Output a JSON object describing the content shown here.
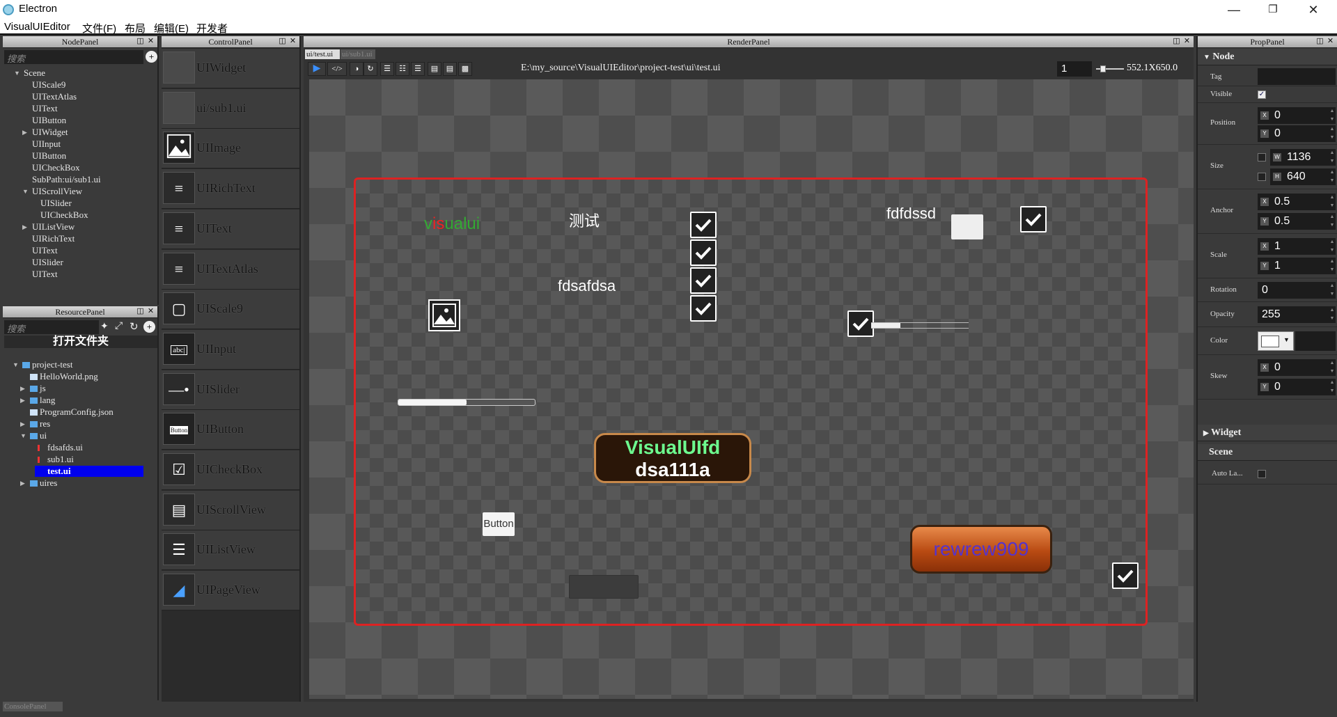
{
  "window": {
    "title": "Electron"
  },
  "menu": [
    "VisualUIEditor",
    "文件(F)",
    "布局",
    "编辑(E)",
    "开发者"
  ],
  "node_panel": {
    "title": "NodePanel",
    "search_placeholder": "搜索",
    "items": [
      "Scene",
      "UIScale9",
      "UITextAtlas",
      "UIText",
      "UIButton",
      "UIWidget",
      "UIInput",
      "UIButton",
      "UICheckBox",
      "SubPath:ui/sub1.ui",
      "UIScrollView",
      "UISlider",
      "UICheckBox",
      "UIListView",
      "UIRichText",
      "UIText",
      "UISlider",
      "UIText"
    ]
  },
  "resource_panel": {
    "title": "ResourcePanel",
    "search_placeholder": "搜索",
    "open_folder": "打开文件夹",
    "items": [
      "project-test",
      "HelloWorld.png",
      "js",
      "lang",
      "ProgramConfig.json",
      "res",
      "ui",
      "fdsafds.ui",
      "sub1.ui",
      "test.ui",
      "uires"
    ]
  },
  "console_panel": {
    "title": "ConsolePanel"
  },
  "control_panel": {
    "title": "ControlPanel",
    "items": [
      "UIWidget",
      "ui/sub1.ui",
      "UIImage",
      "UIRichText",
      "UIText",
      "UITextAtlas",
      "UIScale9",
      "UIInput",
      "UISlider",
      "UIButton",
      "UICheckBox",
      "UIScrollView",
      "UIListView",
      "UIPageView"
    ],
    "button_icon_text": "Button",
    "input_icon_text": "abc|"
  },
  "render_panel": {
    "title": "RenderPanel",
    "tabs": [
      "ui/test.ui",
      "ui/sub1.ui"
    ],
    "path": "E:\\my_source\\VisualUIEditor\\project-test\\ui\\test.ui",
    "zoom_value": "1",
    "size_readout": "552.1X650.0"
  },
  "design": {
    "rich_text": "visualui",
    "text_cn": "测试",
    "text_fdfdssd": "fdfdssd",
    "text_fdsafdsa": "fdsafdsa",
    "big_button_line1": "VisualUIfd",
    "big_button_line2": "dsa111a",
    "small_button": "Button",
    "orange_button": "rewrew909",
    "slider1_fill": 0.5,
    "slider2_fill": 0.3
  },
  "prop_panel": {
    "title": "PropPanel",
    "section_node": "Node",
    "tag_label": "Tag",
    "visible_label": "Visible",
    "position_label": "Position",
    "pos_x": "0",
    "pos_y": "0",
    "size_label": "Size",
    "size_w": "1136",
    "size_h": "640",
    "anchor_label": "Anchor",
    "anchor_x": "0.5",
    "anchor_y": "0.5",
    "scale_label": "Scale",
    "scale_x": "1",
    "scale_y": "1",
    "rotation_label": "Rotation",
    "rotation": "0",
    "opacity_label": "Opacity",
    "opacity": "255",
    "color_label": "Color",
    "skew_label": "Skew",
    "skew_x": "0",
    "skew_y": "0",
    "section_widget": "Widget",
    "section_scene": "Scene",
    "auto_layout_label": "Auto La..."
  },
  "colors": {
    "accent_selection": "#0000ee",
    "border_red": "#dd2222",
    "button_gold": "#c8894a",
    "orange": "#c85a1c"
  }
}
